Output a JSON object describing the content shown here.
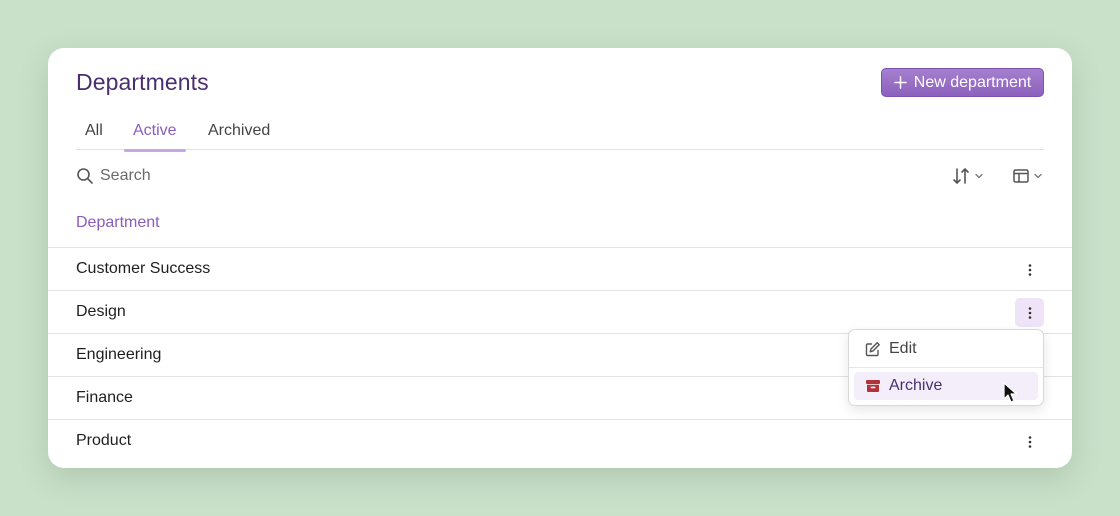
{
  "header": {
    "title": "Departments",
    "new_button_label": "New department"
  },
  "tabs": [
    {
      "label": "All",
      "active": false
    },
    {
      "label": "Active",
      "active": true
    },
    {
      "label": "Archived",
      "active": false
    }
  ],
  "search": {
    "placeholder": "Search",
    "value": ""
  },
  "table": {
    "column_header": "Department",
    "rows": [
      {
        "name": "Customer Success"
      },
      {
        "name": "Design"
      },
      {
        "name": "Engineering"
      },
      {
        "name": "Finance"
      },
      {
        "name": "Product"
      }
    ]
  },
  "context_menu": {
    "items": [
      {
        "label": "Edit",
        "icon": "edit-icon"
      },
      {
        "label": "Archive",
        "icon": "archive-icon"
      }
    ]
  },
  "icons": {
    "new": "plus-icon",
    "search": "search-icon",
    "sort": "sort-arrows-icon",
    "columns": "columns-layout-icon",
    "row_actions": "kebab-menu-icon",
    "chevron": "chevron-down-icon"
  },
  "colors": {
    "background": "#c9e0c9",
    "accent": "#8a5cbd",
    "title": "#4a2f6e",
    "archive_icon": "#b2343a"
  }
}
